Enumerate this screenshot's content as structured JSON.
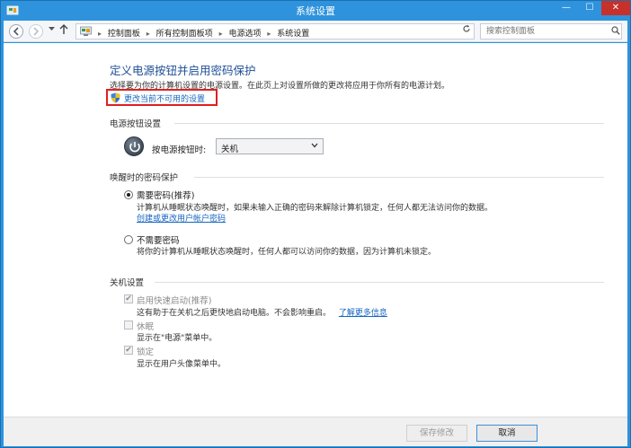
{
  "window": {
    "title": "系统设置",
    "min_glyph": "—",
    "max_glyph": "☐",
    "close_glyph": "✕"
  },
  "address": {
    "crumbs": [
      "控制面板",
      "所有控制面板项",
      "电源选项",
      "系统设置"
    ],
    "search_placeholder": "搜索控制面板"
  },
  "page": {
    "title": "定义电源按钮并启用密码保护",
    "description": "选择要为你的计算机设置的电源设置。在此页上对设置所做的更改将应用于你所有的电源计划。",
    "change_link": "更改当前不可用的设置"
  },
  "power_button": {
    "section_title": "电源按钮设置",
    "label": "按电源按钮时:",
    "selected": "关机"
  },
  "wake_password": {
    "section_title": "唤醒时的密码保护",
    "opt_require_label": "需要密码(推荐)",
    "opt_require_desc": "计算机从睡眠状态唤醒时，如果未输入正确的密码来解除计算机锁定，任何人都无法访问你的数据。",
    "opt_require_link": "创建或更改用户帐户密码",
    "opt_none_label": "不需要密码",
    "opt_none_desc": "将你的计算机从睡眠状态唤醒时，任何人都可以访问你的数据，因为计算机未锁定。"
  },
  "shutdown": {
    "section_title": "关机设置",
    "fast_label": "启用快速启动(推荐)",
    "fast_desc": "这有助于在关机之后更快地启动电脑。不会影响重启。",
    "fast_link": "了解更多信息",
    "hibernate_label": "休眠",
    "hibernate_desc": "显示在\"电源\"菜单中。",
    "lock_label": "锁定",
    "lock_desc": "显示在用户头像菜单中。"
  },
  "footer": {
    "save_label": "保存修改",
    "cancel_label": "取消"
  }
}
